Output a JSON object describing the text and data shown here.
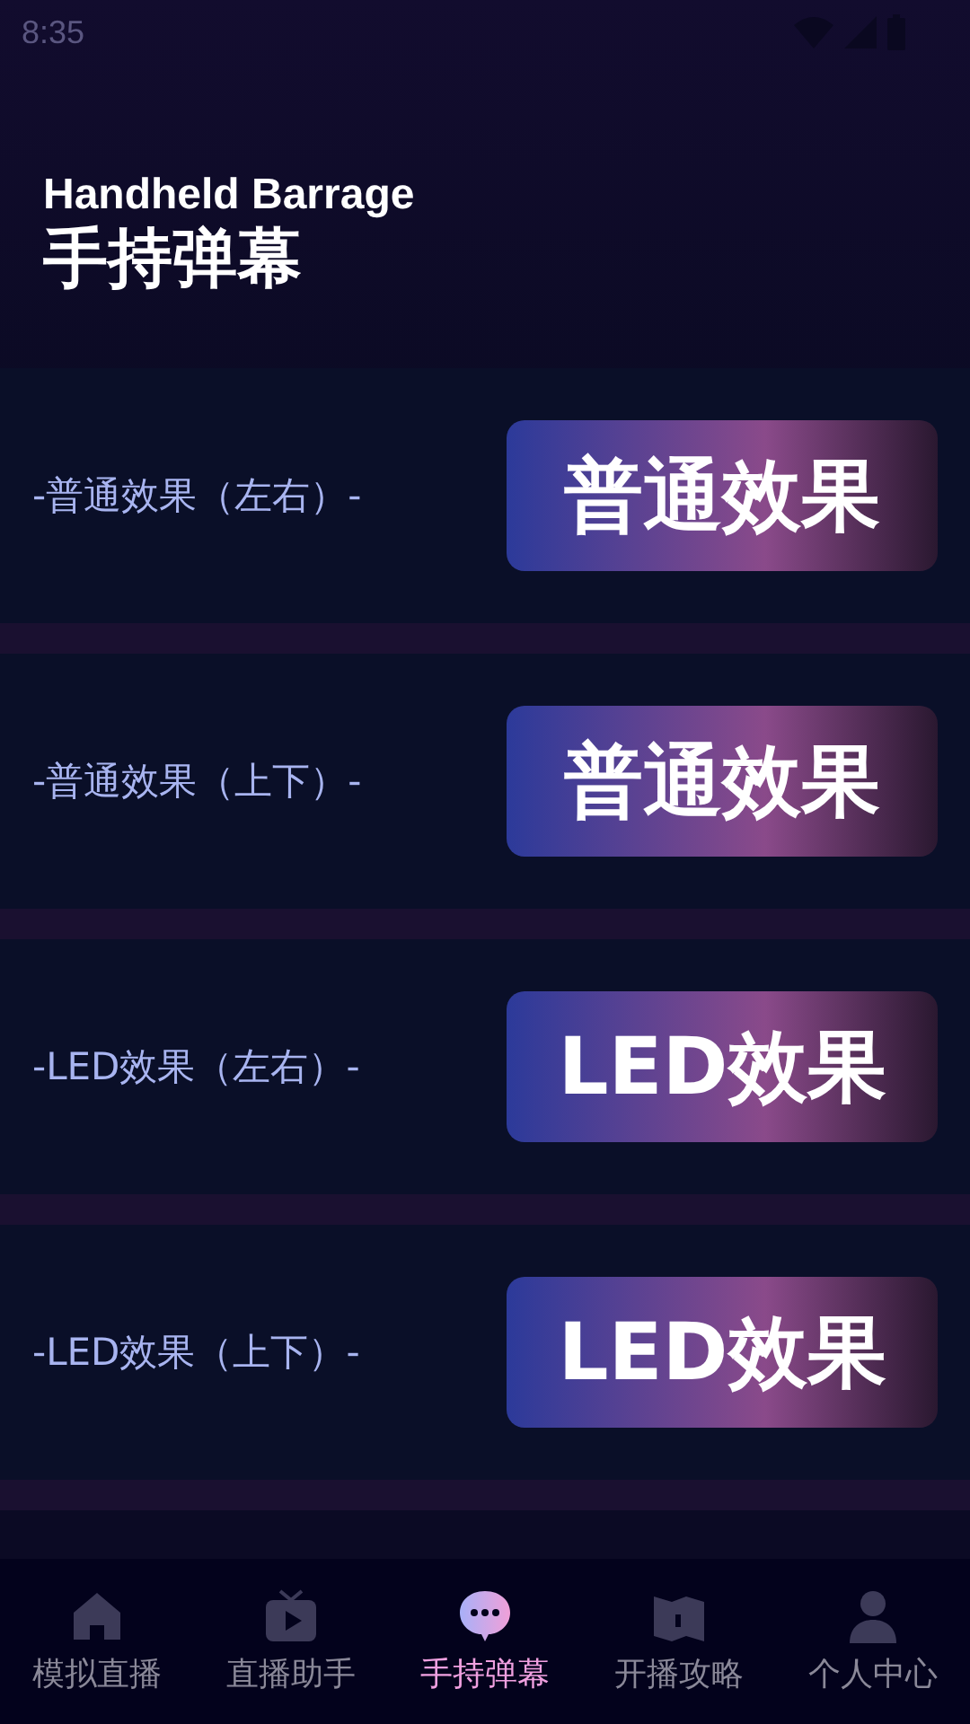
{
  "status_bar": {
    "time": "8:35"
  },
  "header": {
    "subtitle": "Handheld Barrage",
    "title": "手持弹幕"
  },
  "effects": [
    {
      "label": "-普通效果（左右）-",
      "button": "普通效果"
    },
    {
      "label": "-普通效果（上下）-",
      "button": "普通效果"
    },
    {
      "label": "-LED效果（左右）-",
      "button": "LED效果"
    },
    {
      "label": "-LED效果（上下）-",
      "button": "LED效果"
    }
  ],
  "tabs": [
    {
      "kind": "home",
      "label": "模拟直播",
      "selected": false
    },
    {
      "kind": "tv",
      "label": "直播助手",
      "selected": false
    },
    {
      "kind": "chat",
      "label": "手持弹幕",
      "selected": true
    },
    {
      "kind": "book",
      "label": "开播攻略",
      "selected": false
    },
    {
      "kind": "user",
      "label": "个人中心",
      "selected": false
    }
  ]
}
